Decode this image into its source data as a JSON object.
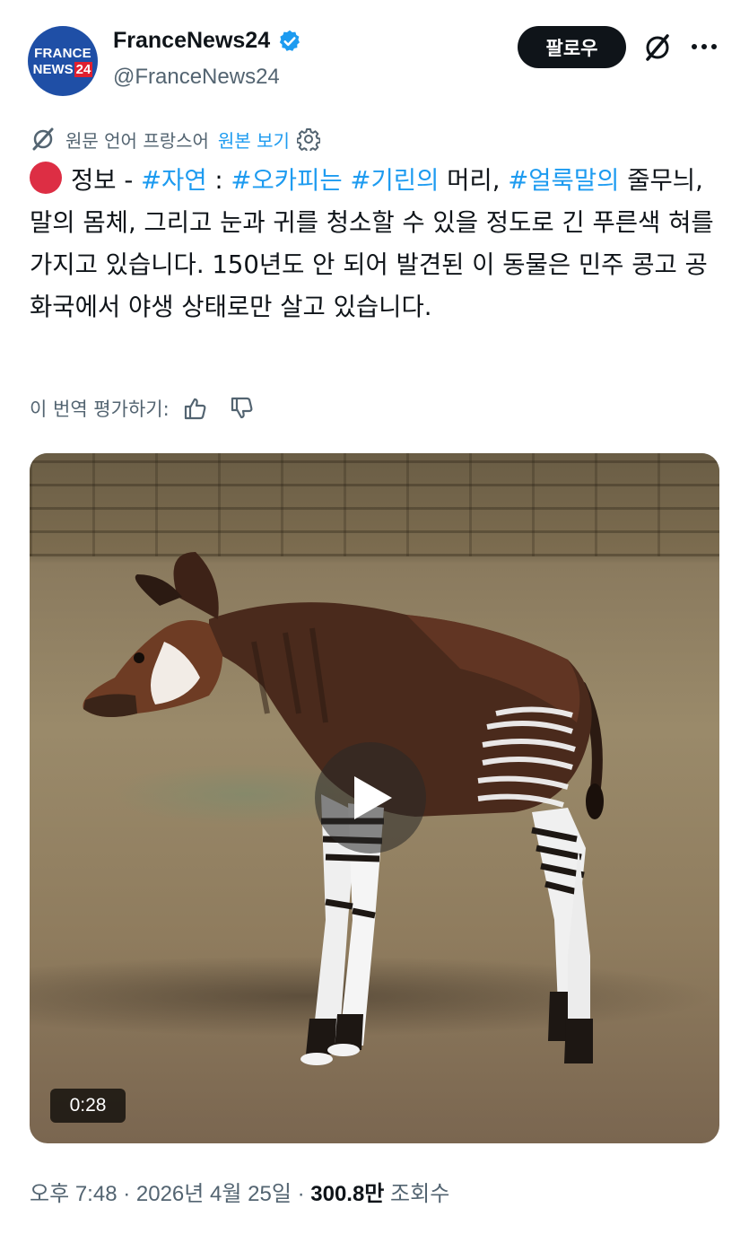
{
  "account": {
    "avatar_text_line1": "FRANCE",
    "avatar_text_line2_prefix": "NEWS",
    "avatar_text_line2_num": "24",
    "display_name": "FranceNews24",
    "handle": "@FranceNews24",
    "verified_icon": "verified-badge-icon",
    "brand_color": "#1f4fa6"
  },
  "header": {
    "follow_label": "팔로우",
    "grok_icon": "grok-icon",
    "more_icon": "more-icon"
  },
  "translation": {
    "source_label": "원문 언어 프랑스어",
    "show_original_label": "원본 보기",
    "rate_label": "이 번역 평가하기:"
  },
  "tweet": {
    "lead": "정보 - ",
    "tag1": "#자연",
    "sep1": " : ",
    "tag2": "#오카피는",
    "sp": " ",
    "tag3": "#기린의",
    "text1": " 머리, ",
    "tag4": "#얼룩말의",
    "text2": " 줄무늬, 말의 몸체, 그리고 눈과 귀를 청소할 수 있을 정도로 긴 푸른색 혀를 가지고 있습니다. 150년도 안 되어 발견된 이 동물은 민주 콩고 공화국에서 야생 상태로만 살고 있습니다."
  },
  "media": {
    "type": "video",
    "duration": "0:28"
  },
  "meta": {
    "time": "오후 7:48",
    "date": "2026년 4월 25일",
    "views_count": "300.8만",
    "views_label": " 조회수"
  },
  "colors": {
    "link": "#1d9bf0",
    "secondary_text": "#536471",
    "red_circle": "#dd2e44"
  }
}
